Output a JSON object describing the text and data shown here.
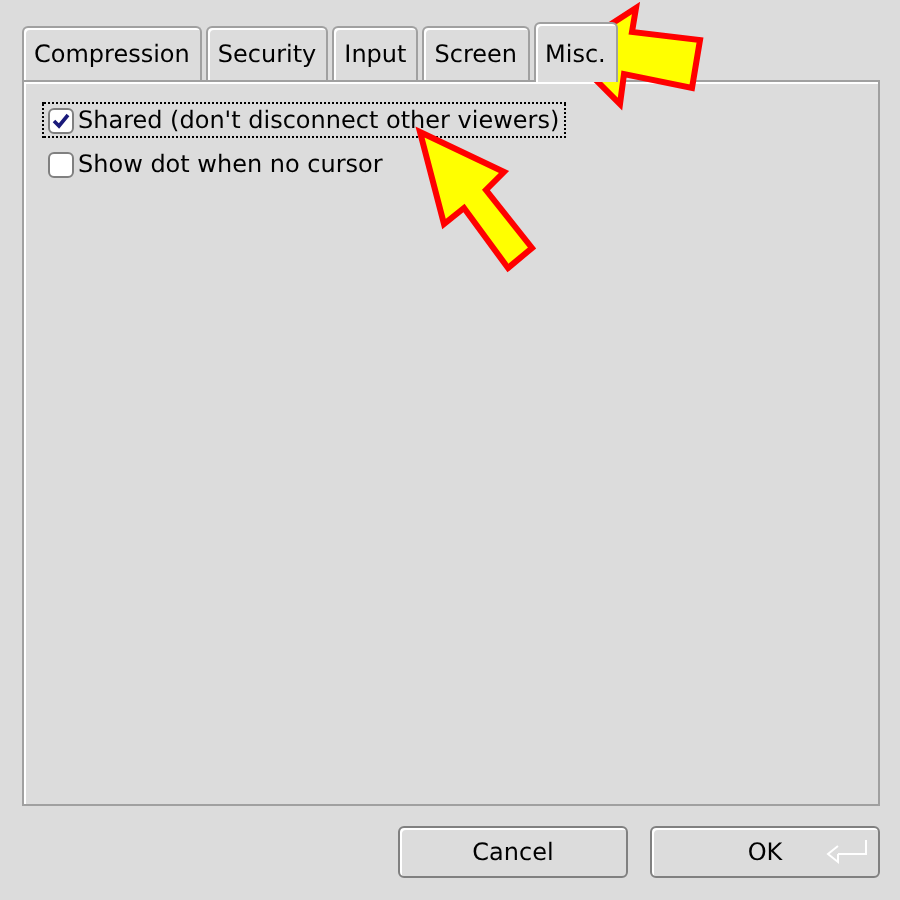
{
  "tabs": [
    {
      "label": "Compression",
      "selected": false
    },
    {
      "label": "Security",
      "selected": false
    },
    {
      "label": "Input",
      "selected": false
    },
    {
      "label": "Screen",
      "selected": false
    },
    {
      "label": "Misc.",
      "selected": true
    }
  ],
  "options": [
    {
      "label": "Shared (don't disconnect other viewers)",
      "checked": true,
      "focused": true
    },
    {
      "label": "Show dot when no cursor",
      "checked": false,
      "focused": false
    }
  ],
  "buttons": [
    {
      "label": "Cancel",
      "kind": "cancel"
    },
    {
      "label": "OK",
      "kind": "default"
    }
  ]
}
